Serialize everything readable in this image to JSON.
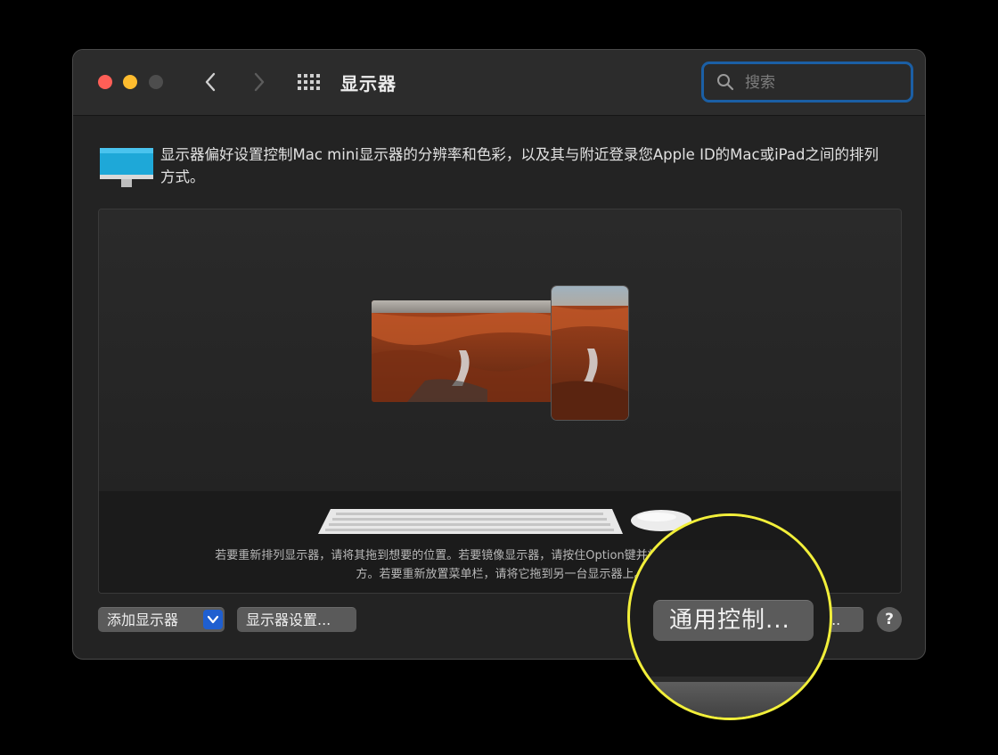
{
  "window": {
    "title": "显示器",
    "search_placeholder": "搜索"
  },
  "description": "显示器偏好设置控制Mac mini显示器的分辨率和色彩，以及其与附近登录您Apple ID的Mac或iPad之间的排列方式。",
  "arrangement": {
    "hint_line1": "若要重新排列显示器，请将其拖到想要的位置。若要镜像显示器，请按住Option键并将其拖到另一台显示器上。",
    "hint_line2": "方。若要重新放置菜单栏，请将它拖到另一台显示器上。",
    "partial_label": "拖"
  },
  "buttons": {
    "add_display": "添加显示器",
    "display_settings": "显示器设置...",
    "universal_control_partial": "...",
    "help": "?"
  },
  "magnifier": {
    "button_label": "通用控制..."
  },
  "colors": {
    "accent_blue": "#1f5fd0",
    "search_focus": "#1b5fa5",
    "highlight_ring": "#f2ef3a"
  }
}
